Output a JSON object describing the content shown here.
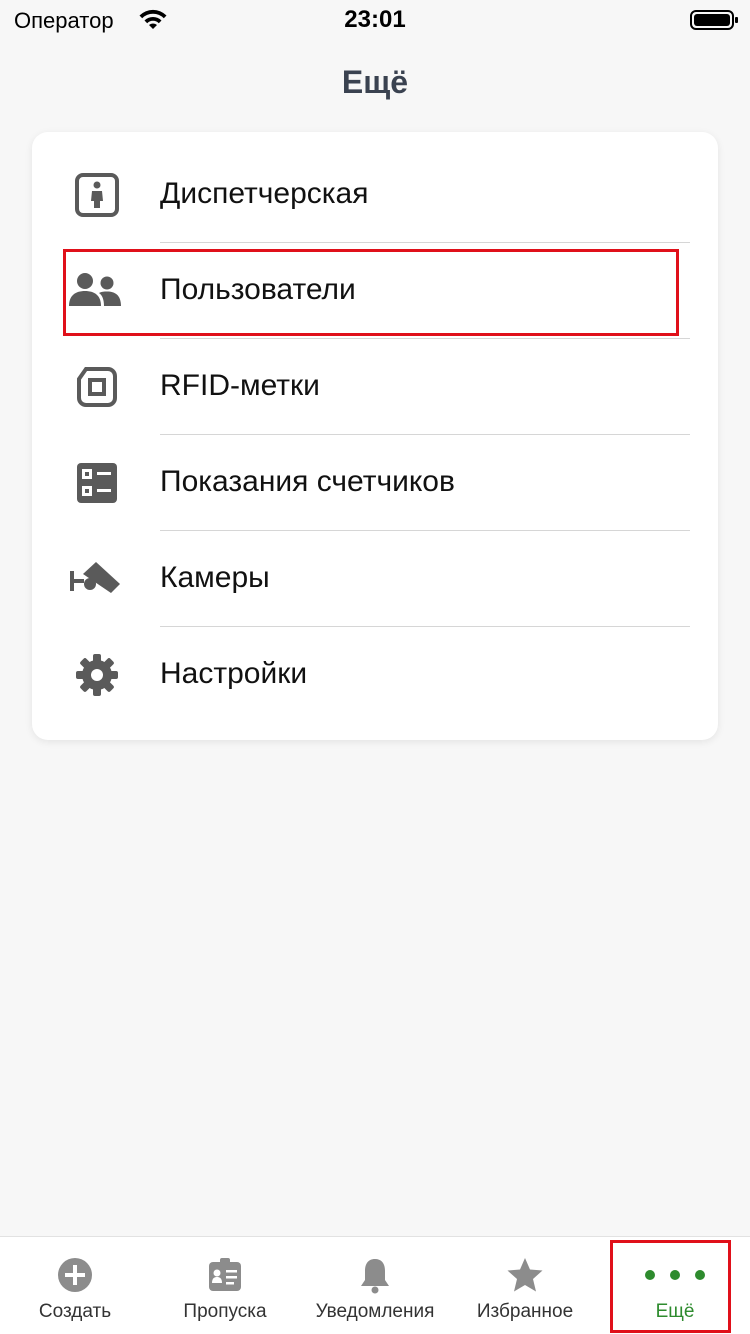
{
  "status_bar": {
    "carrier": "Оператор",
    "time": "23:01"
  },
  "header": {
    "title": "Ещё"
  },
  "menu": {
    "items": [
      {
        "label": "Диспетчерская",
        "icon": "dispatcher-icon"
      },
      {
        "label": "Пользователи",
        "icon": "users-icon"
      },
      {
        "label": "RFID-метки",
        "icon": "rfid-tag-icon"
      },
      {
        "label": "Показания счетчиков",
        "icon": "meter-readings-icon"
      },
      {
        "label": "Камеры",
        "icon": "camera-icon"
      },
      {
        "label": "Настройки",
        "icon": "gear-icon"
      }
    ]
  },
  "tab_bar": {
    "tabs": [
      {
        "label": "Создать",
        "icon": "plus-circle-icon"
      },
      {
        "label": "Пропуска",
        "icon": "pass-icon"
      },
      {
        "label": "Уведомления",
        "icon": "bell-icon"
      },
      {
        "label": "Избранное",
        "icon": "star-icon"
      },
      {
        "label": "Ещё",
        "icon": "more-dots-icon",
        "active": true
      }
    ]
  },
  "colors": {
    "accent": "#2e8b2e",
    "icon_gray": "#5a5a5a",
    "highlight": "#e0101a",
    "title": "#3a4250"
  }
}
